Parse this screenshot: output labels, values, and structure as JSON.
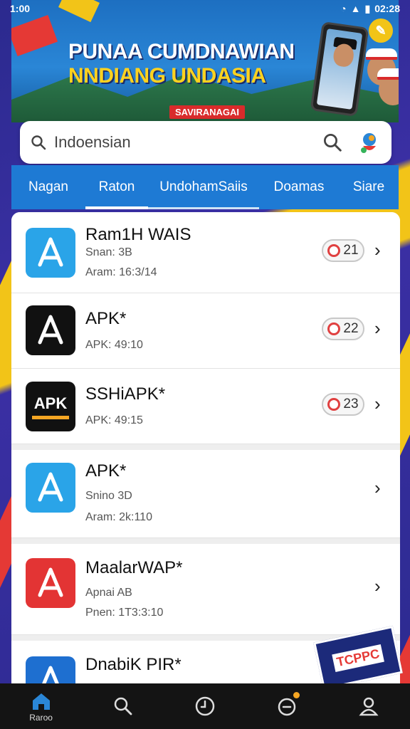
{
  "status_bar": {
    "time": "1:00",
    "battery": "02:28"
  },
  "banner": {
    "title_line1": "PUNAA CUMDNAWIAN",
    "title_line2": "NNDIANG UNDASIA",
    "tag": "SAVIRANAGAI"
  },
  "search": {
    "value": "Indoensian",
    "placeholder": "Indoensian"
  },
  "tabs": [
    {
      "label": "Nagan"
    },
    {
      "label": "Raton"
    },
    {
      "label": "UndohamSaiis"
    },
    {
      "label": "Doamas"
    },
    {
      "label": "Siare"
    }
  ],
  "apps": [
    {
      "name": "Ram1H WAIS",
      "line1": "Snan: 3B",
      "line2": "Aram: 16:3/14",
      "badge": "21",
      "icon_color": "#2aa4e8",
      "icon": "app-store-icon"
    },
    {
      "name": "APK*",
      "line1": "APK: 49:10",
      "line2": "",
      "badge": "22",
      "icon_color": "#111111",
      "icon": "app-store-icon"
    },
    {
      "name": "SSHiAPK*",
      "line1": "APK: 49:15",
      "line2": "",
      "badge": "23",
      "icon_color": "#111111",
      "icon": "apk-icon",
      "icon_text": "APK"
    },
    {
      "name": "APK*",
      "line1": "Snino 3D",
      "line2": "Aram: 2k:110",
      "badge": "",
      "icon_color": "#2aa4e8",
      "icon": "app-store-icon"
    },
    {
      "name": "MaalarWAP*",
      "line1": "Apnai AB",
      "line2": "Pnen: 1T3:3:10",
      "badge": "",
      "icon_color": "#e33434",
      "icon": "app-store-icon"
    },
    {
      "name": "DnabiK PIR*",
      "line1": "",
      "line2": "",
      "badge": "",
      "icon_color": "#1e6fd0",
      "icon": "app-store-icon"
    }
  ],
  "bottom_nav": [
    {
      "label": "Raroo",
      "icon": "home-icon"
    },
    {
      "label": "",
      "icon": "search-icon"
    },
    {
      "label": "",
      "icon": "clock-icon"
    },
    {
      "label": "",
      "icon": "notifications-icon"
    },
    {
      "label": "",
      "icon": "profile-icon"
    }
  ],
  "promo": {
    "text": "TCPPC"
  },
  "colors": {
    "tab_bar": "#1e7ad4",
    "accent_red": "#e53935",
    "accent_yellow": "#f2c418"
  }
}
